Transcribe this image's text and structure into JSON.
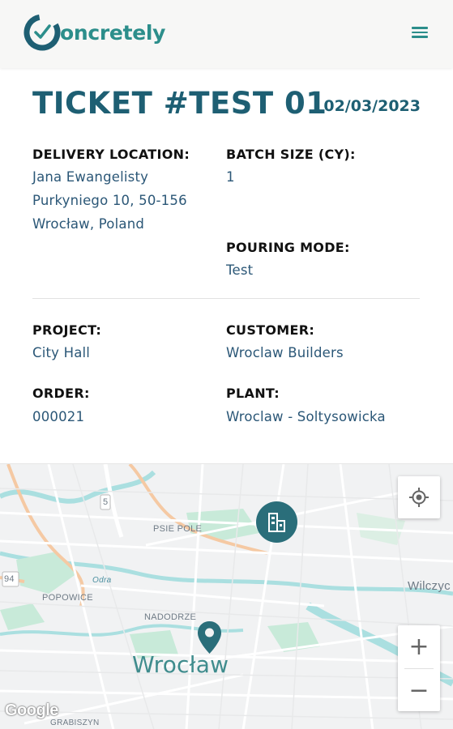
{
  "header": {
    "logo_text": "oncretely",
    "logo_icon": "clock-check-icon",
    "menu_icon": "hamburger-menu-icon"
  },
  "ticket": {
    "title": "TICKET #TEST 01",
    "date": "02/03/2023"
  },
  "fields": {
    "delivery_location": {
      "label": "DELIVERY LOCATION:",
      "lines": [
        "Jana Ewangelisty",
        "Purkyniego 10, 50-156",
        "Wrocław, Poland"
      ]
    },
    "batch_size": {
      "label": "BATCH SIZE (CY):",
      "value": "1"
    },
    "pouring_mode": {
      "label": "POURING MODE:",
      "value": "Test"
    },
    "project": {
      "label": "PROJECT:",
      "value": "City Hall"
    },
    "customer": {
      "label": "CUSTOMER:",
      "value": "Wroclaw Builders"
    },
    "order": {
      "label": "ORDER:",
      "value": "000021"
    },
    "plant": {
      "label": "PLANT:",
      "value": "Wroclaw - Soltysowicka"
    }
  },
  "map": {
    "city_label": "Wrocław",
    "labels": {
      "psie_pole": "PSIE POLE",
      "popowice": "POPOWICE",
      "nadodrze": "NADODRZE",
      "odra": "Odra",
      "wilczyce": "Wilczyc",
      "grabiszyn": "GRABISZYN",
      "route_5": "5",
      "route_94": "94"
    },
    "zoom_in": "+",
    "zoom_out": "−",
    "attribution": "Google",
    "colors": {
      "accent": "#2c8e8b",
      "title": "#1e5f73",
      "value": "#2b5777",
      "marker": "#2a6e7a",
      "park": "#c8ead9",
      "water": "#aadfe0",
      "major_road": "#f5c9a3"
    }
  }
}
